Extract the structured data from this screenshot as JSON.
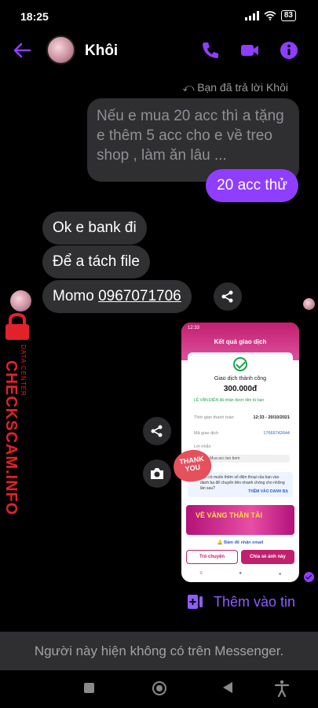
{
  "status_bar": {
    "time": "18:25",
    "battery": "83"
  },
  "header": {
    "contact_name": "Khôi"
  },
  "messages": {
    "reply_note": "Bạn đã trả lời Khôi",
    "quoted_text": "Nếu e mua 20 acc thì a tặng e thêm 5 acc cho e về treo shop , làm ăn lâu ...",
    "outgoing_1": "20 acc thử",
    "incoming_1": "Ok e bank đi",
    "incoming_2": "Để a tách file",
    "incoming_3_prefix": "Momo ",
    "incoming_3_number": "0967071706"
  },
  "watermark": {
    "brand": "CHECKSCAM.INFO",
    "sub": "DATA CENTER"
  },
  "receipt": {
    "time": "12:33",
    "title": "Kết quả giao dịch",
    "status": "Giao dịch thành công",
    "amount": "300.000đ",
    "recipient": "LÊ VĂN ĐIỆN đã nhận được tiền từ bạn",
    "row1_label": "Thời gian thanh toán",
    "row1_value": "12:33 - 20/10/2021",
    "row2_label": "Mã giao dịch",
    "row2_value": "17666742644",
    "row3_label": "Lời nhắn",
    "message": "Mua acc tan bem",
    "notice": "Bạn có muốn thêm số điện thoại của bạn vào danh bạ để chuyển tiền nhanh chóng cho những lần sau?",
    "notice_action": "THÊM VÀO DANH BẠ",
    "banner": "VỀ VÀNG THẦN TÀI",
    "bell": "Bấm để nhận email",
    "btn_left": "Trò chuyện",
    "btn_right": "Chia sẻ ảnh này",
    "sticker": "THANK YOU"
  },
  "add_to_story": "Thêm vào tin",
  "footer_notice": "Người này hiện không có trên Messenger.",
  "colors": {
    "accent": "#8f3dff",
    "bubble_in": "#303033",
    "momo": "#c0206d"
  }
}
